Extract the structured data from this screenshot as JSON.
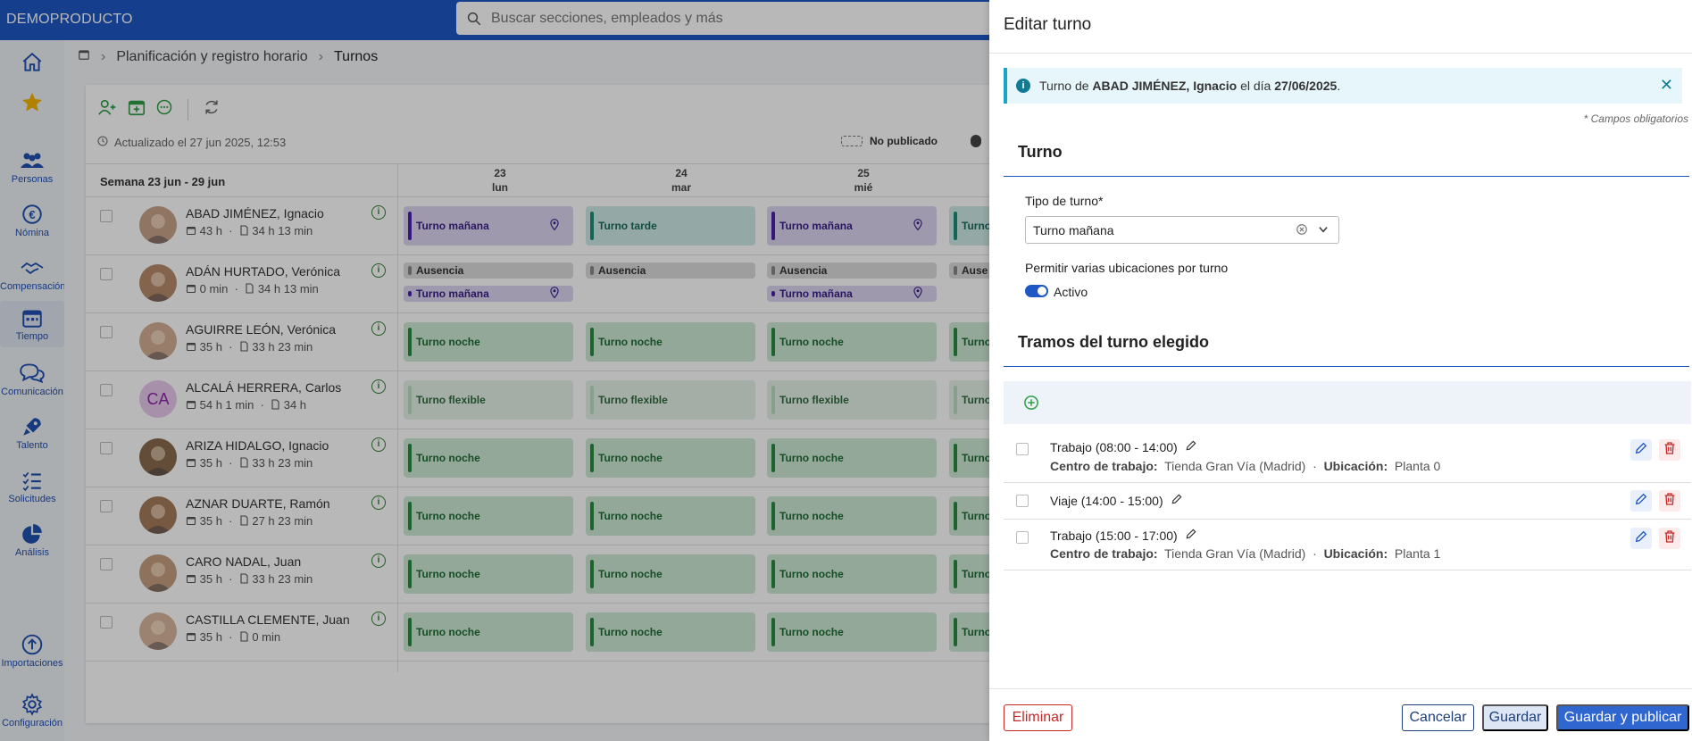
{
  "brand": "DEMOPRODUCTO",
  "search": {
    "placeholder": "Buscar secciones, empleados y más"
  },
  "nav": [
    {
      "label": "",
      "icon": "home-icon"
    },
    {
      "label": "",
      "icon": "star-icon"
    },
    {
      "label": "Personas",
      "icon": "people-icon"
    },
    {
      "label": "Nómina",
      "icon": "euro-icon"
    },
    {
      "label": "Compensación",
      "icon": "handshake-icon"
    },
    {
      "label": "Tiempo",
      "icon": "calendar-icon"
    },
    {
      "label": "Comunicación",
      "icon": "chat-icon"
    },
    {
      "label": "Talento",
      "icon": "rocket-icon"
    },
    {
      "label": "Solicitudes",
      "icon": "list-check-icon"
    },
    {
      "label": "Análisis",
      "icon": "pie-chart-icon"
    },
    {
      "label": "Importaciones",
      "icon": "upload-icon"
    },
    {
      "label": "Configuración",
      "icon": "gear-icon"
    }
  ],
  "breadcrumb": {
    "section": "Planificación y registro horario",
    "current": "Turnos"
  },
  "updated": "Actualizado el 27 jun 2025, 12:53",
  "legend": {
    "unpublished": "No publicado"
  },
  "week_label": "Semana 23 jun - 29 jun",
  "days": [
    {
      "num": "23",
      "name": "lun"
    },
    {
      "num": "24",
      "name": "mar"
    },
    {
      "num": "25",
      "name": "mié"
    }
  ],
  "employees": [
    {
      "name": "ABAD JIMÉNEZ, Ignacio",
      "planned": "43 h",
      "worked": "34 h 13 min"
    },
    {
      "name": "ADÁN HURTADO, Verónica",
      "planned": "0 min",
      "worked": "34 h 13 min"
    },
    {
      "name": "AGUIRRE LEÓN, Verónica",
      "planned": "35 h",
      "worked": "33 h 23 min"
    },
    {
      "name": "ALCALÁ HERRERA, Carlos",
      "planned": "54 h 1 min",
      "worked": "34 h",
      "initials": "CA"
    },
    {
      "name": "ARIZA HIDALGO, Ignacio",
      "planned": "35 h",
      "worked": "33 h 23 min"
    },
    {
      "name": "AZNAR DUARTE, Ramón",
      "planned": "35 h",
      "worked": "27 h 23 min"
    },
    {
      "name": "CARO NADAL, Juan",
      "planned": "35 h",
      "worked": "33 h 23 min"
    },
    {
      "name": "CASTILLA CLEMENTE, Juan",
      "planned": "35 h",
      "worked": "0 min"
    }
  ],
  "shifts": {
    "morning": "Turno mañana",
    "afternoon": "Turno tarde",
    "night": "Turno noche",
    "flexible": "Turno flexible",
    "absence": "Ausencia",
    "truncated_morning": "Turno",
    "truncated_absence": "Ause"
  },
  "drawer": {
    "title": "Editar turno",
    "alert": {
      "prefix": "Turno de ",
      "employee": "ABAD JIMÉNEZ, Ignacio",
      "middle": " el día ",
      "date": "27/06/2025",
      "suffix": "."
    },
    "required_note": "* Campos obligatorios",
    "section_shift": "Turno",
    "shift_type_label": "Tipo de turno*",
    "shift_type_value": "Turno mañana",
    "multi_location_label": "Permitir varias ubicaciones por turno",
    "multi_location_state": "Activo",
    "section_segments": "Tramos del turno elegido",
    "segments": [
      {
        "title": "Trabajo (08:00 - 14:00)",
        "center_label": "Centro de trabajo:",
        "center": "Tienda Gran Vía (Madrid)",
        "loc_label": "Ubicación:",
        "loc": "Planta 0"
      },
      {
        "title": "Viaje (14:00 - 15:00)"
      },
      {
        "title": "Trabajo (15:00 - 17:00)",
        "center_label": "Centro de trabajo:",
        "center": "Tienda Gran Vía (Madrid)",
        "loc_label": "Ubicación:",
        "loc": "Planta 1"
      }
    ],
    "buttons": {
      "delete": "Eliminar",
      "cancel": "Cancelar",
      "save": "Guardar",
      "save_publish": "Guardar y publicar"
    }
  },
  "colors": {
    "primary": "#1e56c4",
    "danger": "#c62828",
    "info": "#1aa5c7"
  }
}
